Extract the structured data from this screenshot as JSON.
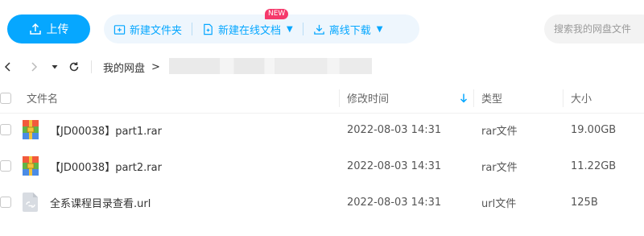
{
  "toolbar": {
    "upload_label": "上传",
    "new_folder_label": "新建文件夹",
    "new_online_doc_label": "新建在线文档",
    "new_badge": "NEW",
    "offline_download_label": "离线下载",
    "search_placeholder": "搜索我的网盘文件"
  },
  "nav": {
    "breadcrumb_root": "我的网盘",
    "breadcrumb_sep": ">"
  },
  "table": {
    "headers": {
      "name": "文件名",
      "modified": "修改时间",
      "type": "类型",
      "size": "大小"
    },
    "rows": [
      {
        "name": "【JD00038】part1.rar",
        "modified": "2022-08-03 14:31",
        "type": "rar文件",
        "size": "19.00GB",
        "icon": "rar-archive-icon"
      },
      {
        "name": "【JD00038】part2.rar",
        "modified": "2022-08-03 14:31",
        "type": "rar文件",
        "size": "11.22GB",
        "icon": "rar-archive-icon"
      },
      {
        "name": "全系课程目录查看.url",
        "modified": "2022-08-03 14:31",
        "type": "url文件",
        "size": "125B",
        "icon": "link-file-icon"
      }
    ]
  },
  "colors": {
    "accent": "#06a7ff",
    "badge": "#f5396b",
    "action_bg": "#eef6fd"
  }
}
